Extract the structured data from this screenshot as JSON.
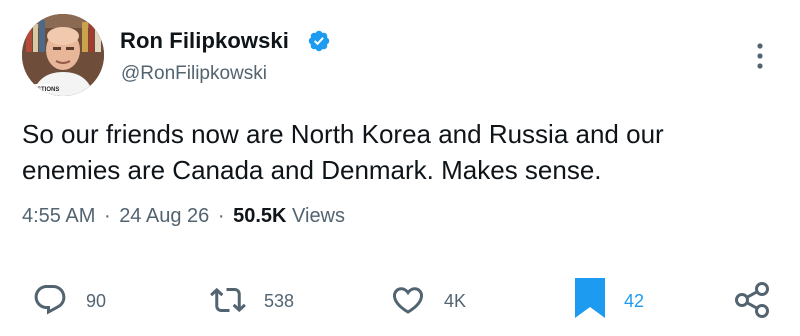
{
  "author": {
    "name": "Ron Filipkowski",
    "handle": "@RonFilipkowski",
    "verified": true,
    "avatar_caption": "QUESTIONS"
  },
  "tweet": {
    "text_line1": "So our friends now are North Korea and Russia and our",
    "text_line2": "enemies are Canada and Denmark. Makes sense."
  },
  "meta": {
    "time": "4:55 AM",
    "separator": "·",
    "date": "24 Aug 26",
    "views_count": "50.5K",
    "views_label": "Views"
  },
  "actions": {
    "replies": "90",
    "reposts": "538",
    "likes": "4K",
    "bookmarks": "42"
  },
  "colors": {
    "text": "#0f1419",
    "secondary": "#536471",
    "verified_blue": "#1d9bf0",
    "bookmark_blue": "#1d9bf0"
  },
  "icons": [
    "verified-badge-icon",
    "more-options-icon",
    "reply-icon",
    "repost-icon",
    "like-icon",
    "bookmark-icon",
    "share-icon"
  ]
}
